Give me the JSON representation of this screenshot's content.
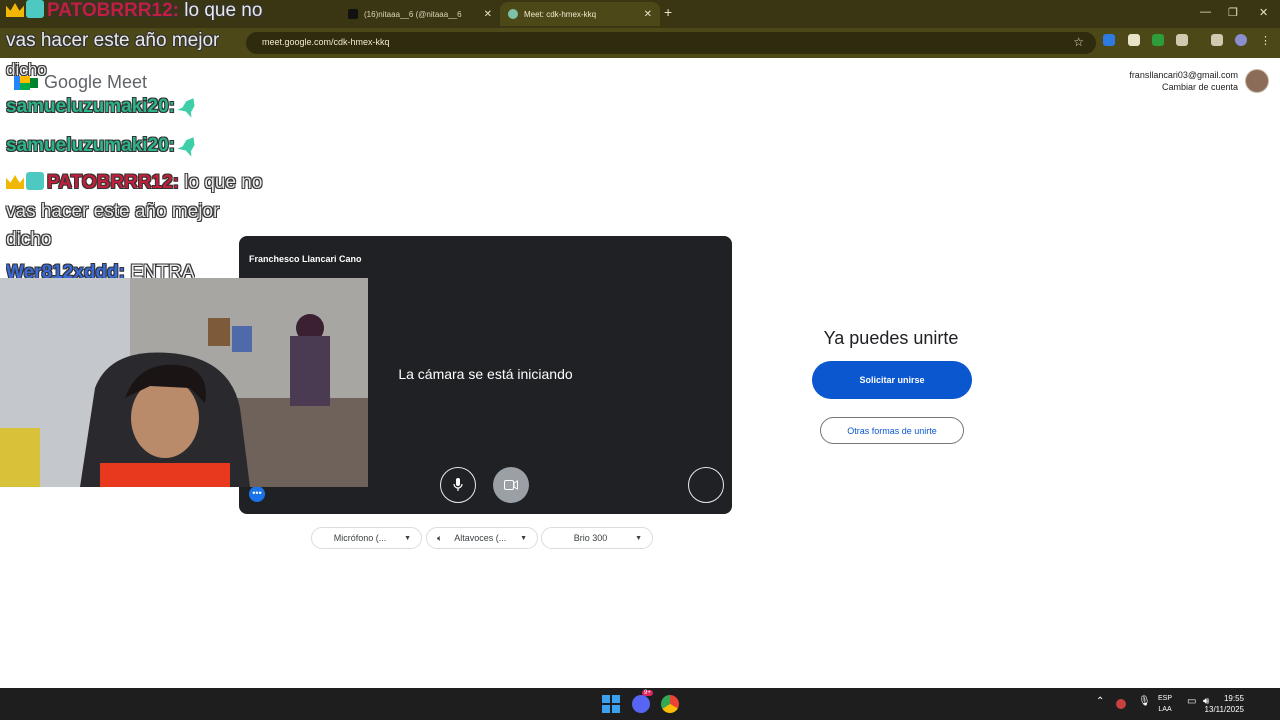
{
  "browser": {
    "tabs": [
      {
        "label": "(16)nitaaa__6 (@nitaaa__6",
        "close": "✕"
      },
      {
        "label": "Meet: cdk-hmex-kkq",
        "close": "✕"
      }
    ],
    "new_tab": "+",
    "url": "meet.google.com/cdk-hmex-kkq",
    "window_controls": [
      "—",
      "❐",
      "✕"
    ]
  },
  "meet": {
    "brand": "Google Meet",
    "account_email": "fransllancari03@gmail.com",
    "switch_account": "Cambiar de cuenta",
    "participant_name": "Franchesco Llancari Cano",
    "camera_status": "La cámara se está iniciando",
    "ready_title": "Ya puedes unirte",
    "join_button": "Solicitar unirse",
    "other_ways_button": "Otras formas de unirte",
    "devices": {
      "microphone": "Micrófono (...",
      "speakers": "Altavoces (...",
      "camera": "Brio 300"
    },
    "accent_color": "#0b57d0"
  },
  "stream_chat": [
    {
      "user": "PATOBRRR12:",
      "message": "lo que no",
      "user_color": "#c21f3a"
    },
    {
      "message": "vas hacer este año mejor"
    },
    {
      "message": "dicho"
    },
    {
      "user": "samueluzumaki20:",
      "message": "",
      "user_color": "#2bb38a"
    },
    {
      "user": "samueluzumaki20:",
      "message": "",
      "user_color": "#2bb38a"
    },
    {
      "user": "PATOBRRR12:",
      "message": "lo que no",
      "user_color": "#c21f3a"
    },
    {
      "message": "vas hacer este año mejor"
    },
    {
      "message": "dicho"
    },
    {
      "user": "Wer812xddd:",
      "message": "ENTRA",
      "user_color": "#3a6bd8"
    }
  ],
  "taskbar": {
    "lang_top": "ESP",
    "lang_bottom": "LAA",
    "time": "19:55",
    "date": "13/11/2025",
    "discord_badge": "9+"
  },
  "icons": [
    "google-meet-logo",
    "star-icon",
    "extension-icons",
    "mic-icon",
    "video-icon",
    "more-icon",
    "speaker-icon",
    "windows-start-icon",
    "discord-icon",
    "chrome-icon"
  ]
}
